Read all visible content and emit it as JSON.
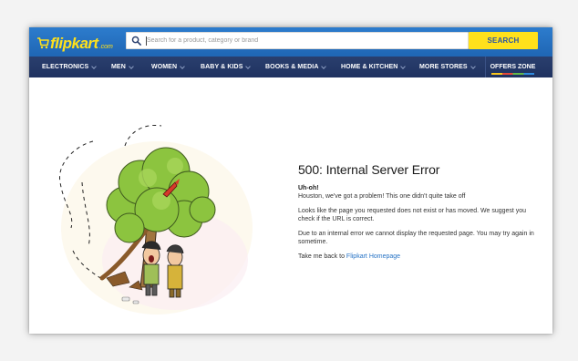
{
  "header": {
    "logo": {
      "text": "flipkart",
      "suffix": ".com"
    },
    "search": {
      "placeholder": "Search for a product, category or brand",
      "value": ""
    },
    "search_button": "SEARCH"
  },
  "nav": {
    "items": [
      {
        "label": "ELECTRONICS"
      },
      {
        "label": "MEN"
      },
      {
        "label": "WOMEN"
      },
      {
        "label": "BABY & KIDS"
      },
      {
        "label": "BOOKS & MEDIA"
      },
      {
        "label": "HOME & KITCHEN"
      },
      {
        "label": "MORE STORES"
      }
    ],
    "offers": "OFFERS ZONE"
  },
  "error": {
    "title": "500: Internal Server Error",
    "uh_oh": "Uh-oh!",
    "line1": "Houston, we've got a problem! This one didn't quite take off",
    "line2": "Looks like the page you requested does not exist or has moved. We suggest you check if the URL is correct.",
    "line3": "Due to an internal error we cannot display the requested page. You may try again in sometime.",
    "back_prefix": "Take me back to ",
    "back_link": "Flipkart Homepage"
  },
  "colors": {
    "header_blue": "#2874c6",
    "nav_navy": "#243864",
    "brand_yellow": "#ffe11b",
    "link_blue": "#2874c6"
  },
  "icons": [
    "flipkart-cart-icon",
    "search-icon",
    "chevron-down-icon"
  ]
}
